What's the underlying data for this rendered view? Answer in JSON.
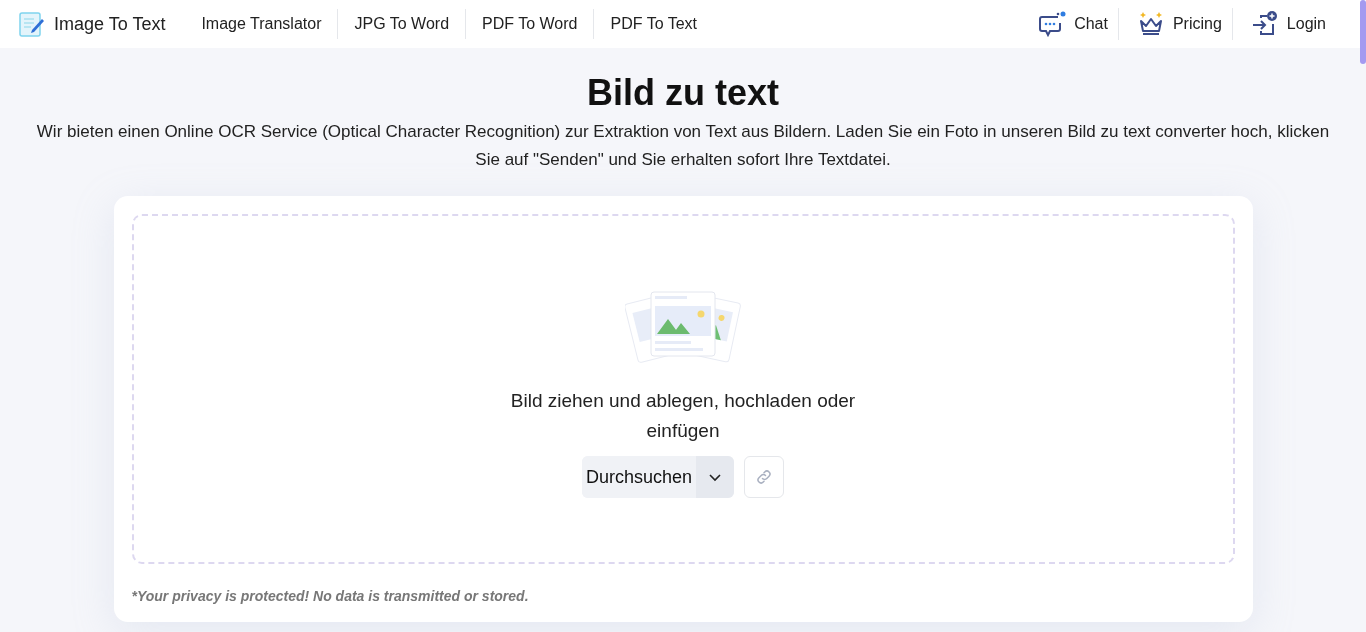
{
  "header": {
    "logo": "Image To Text",
    "nav": [
      "Image Translator",
      "JPG To Word",
      "PDF To Word",
      "PDF To Text"
    ],
    "actions": [
      {
        "kind": "chat",
        "label": "Chat"
      },
      {
        "kind": "pricing",
        "label": "Pricing"
      },
      {
        "kind": "login",
        "label": "Login"
      }
    ]
  },
  "title": "Bild zu text",
  "description": "Wir bieten einen Online OCR Service (Optical Character Recognition) zur Extraktion von Text aus Bildern. Laden Sie ein Foto in unseren Bild zu text converter hoch, klicken Sie auf \"Senden\" und Sie erhalten sofort Ihre Textdatei.",
  "upload": {
    "prompt": "Bild ziehen und ablegen, hochladen oder einfügen",
    "browse_button": "Durchsuchen"
  },
  "privacy_note": "*Your privacy is protected! No data is transmitted or stored."
}
